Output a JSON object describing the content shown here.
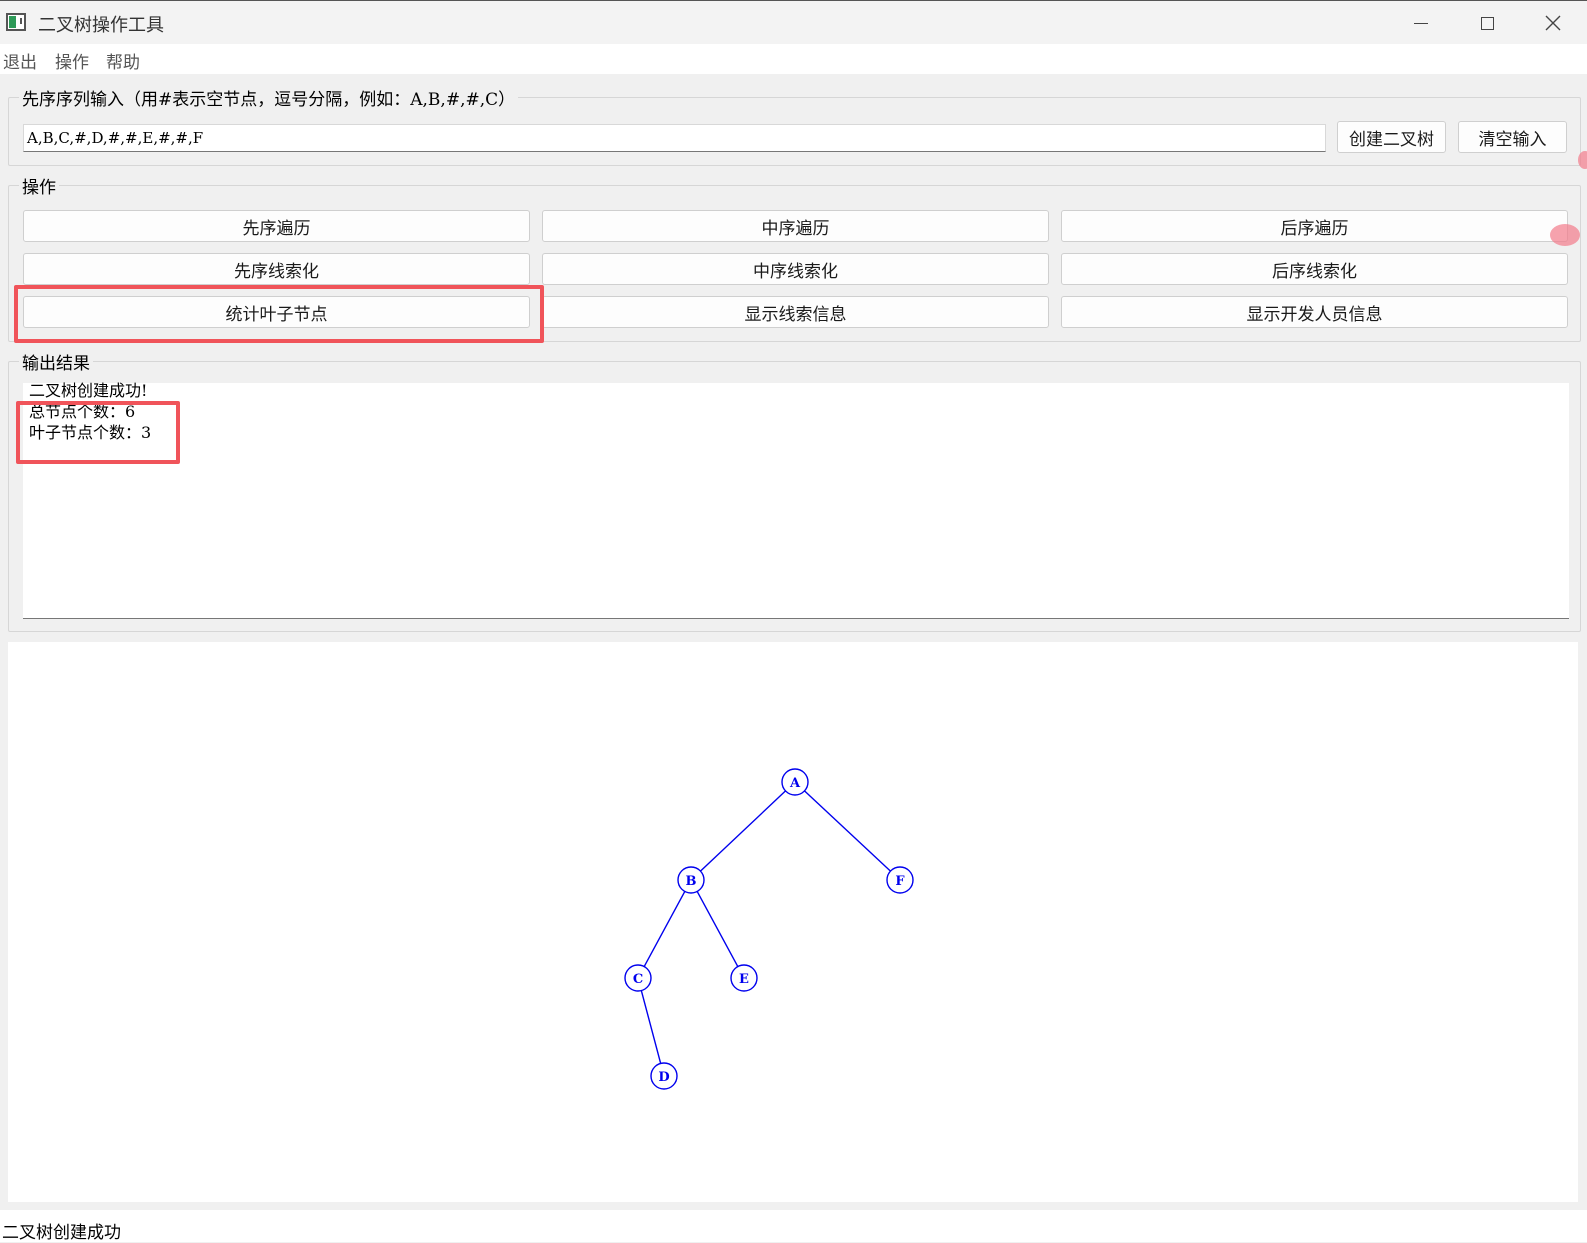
{
  "window": {
    "title": "二叉树操作工具",
    "controls": {
      "minimize": "minimize-icon",
      "maximize": "maximize-icon",
      "close": "close-icon"
    }
  },
  "menu": {
    "items": [
      "退出",
      "操作",
      "帮助"
    ]
  },
  "input_group": {
    "title": "先序序列输入（用#表示空节点，逗号分隔，例如：A,B,#,#,C）",
    "value": "A,B,C,#,D,#,#,E,#,#,F",
    "create_label": "创建二叉树",
    "clear_label": "清空输入"
  },
  "ops_group": {
    "title": "操作",
    "buttons": [
      "先序遍历",
      "中序遍历",
      "后序遍历",
      "先序线索化",
      "中序线索化",
      "后序线索化",
      "统计叶子节点",
      "显示线索信息",
      "显示开发人员信息"
    ]
  },
  "output_group": {
    "title": "输出结果",
    "lines": [
      "二叉树创建成功!",
      "总节点个数：6",
      "叶子节点个数：3"
    ]
  },
  "tree": {
    "color": "#0000ee",
    "nodes": [
      "A",
      "B",
      "F",
      "C",
      "E",
      "D"
    ],
    "edges": [
      [
        "A",
        "B"
      ],
      [
        "A",
        "F"
      ],
      [
        "B",
        "C"
      ],
      [
        "B",
        "E"
      ],
      [
        "C",
        "D"
      ]
    ]
  },
  "status": {
    "text": "二叉树创建成功"
  },
  "colors": {
    "highlight": "#f0545a",
    "tree": "#0000ee"
  }
}
